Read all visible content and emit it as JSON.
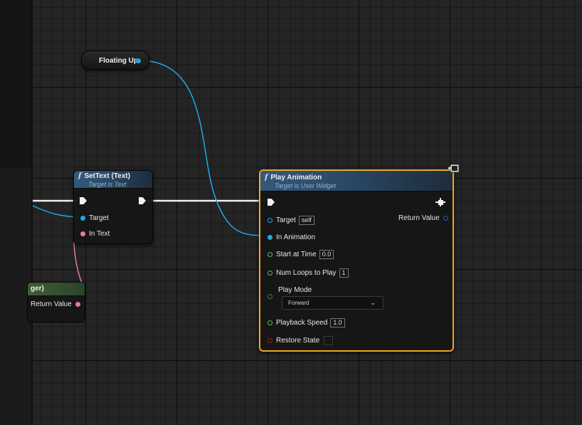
{
  "nodes": {
    "floating_up": {
      "label": "Floating Up"
    },
    "set_text": {
      "title": "SetText (Text)",
      "subtitle": "Target is Text",
      "pins": {
        "target": "Target",
        "in_text": "In Text"
      }
    },
    "partial_node": {
      "title": "ger)",
      "return_label": "Return Value"
    },
    "play_animation": {
      "title": "Play Animation",
      "subtitle": "Target is User Widget",
      "pins": {
        "target": {
          "label": "Target",
          "value": "self"
        },
        "return_value": "Return Value",
        "in_animation": "In Animation",
        "start_at_time": {
          "label": "Start at Time",
          "value": "0.0"
        },
        "num_loops": {
          "label": "Num Loops to Play",
          "value": "1"
        },
        "play_mode": {
          "label": "Play Mode",
          "selected": "Forward"
        },
        "playback_speed": {
          "label": "Playback Speed",
          "value": "1.0"
        },
        "restore_state": "Restore State"
      }
    }
  },
  "icons": {
    "function": "f",
    "dropdown": "chevron-down-icon",
    "comment": "comment-bubble-icon",
    "cursor": "move-cursor-icon"
  },
  "colors": {
    "object_pin": "#1fa8e8",
    "text_pin": "#e27aa8",
    "float_pin": "#59c25a",
    "bool_pin": "#8a1f1f",
    "selection": "#f2a623",
    "header": "#34587c"
  }
}
